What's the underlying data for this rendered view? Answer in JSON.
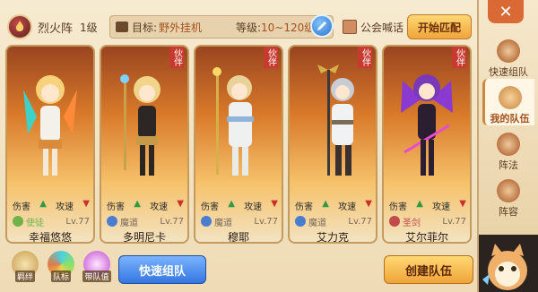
{
  "header": {
    "formation_name": "烈火阵",
    "formation_level": "1级",
    "target_label": "目标:",
    "target_value": "野外挂机",
    "level_label": "等级:",
    "level_value": "10~120级",
    "guild_label": "公会喊话",
    "start_match_label": "开始匹配"
  },
  "cards": [
    {
      "name": "幸福悠悠",
      "class": "使徒",
      "level": "Lv.77",
      "role_left": "伤害",
      "role_right": "攻速",
      "partner_tag": "",
      "class_color": "#6fb24a"
    },
    {
      "name": "多明尼卡",
      "class": "魔道",
      "level": "Lv.77",
      "role_left": "伤害",
      "role_right": "攻速",
      "partner_tag": "伙伴",
      "class_color": "#4a7cd0"
    },
    {
      "name": "穆耶",
      "class": "魔道",
      "level": "Lv.77",
      "role_left": "伤害",
      "role_right": "攻速",
      "partner_tag": "伙伴",
      "class_color": "#4a7cd0"
    },
    {
      "name": "艾力克",
      "class": "魔道",
      "level": "Lv.77",
      "role_left": "伤害",
      "role_right": "攻速",
      "partner_tag": "伙伴",
      "class_color": "#4a7cd0"
    },
    {
      "name": "艾尔菲尔",
      "class": "圣剑",
      "level": "Lv.77",
      "role_left": "伤害",
      "role_right": "攻速",
      "partner_tag": "伙伴",
      "class_color": "#c24a4a"
    }
  ],
  "bottom": {
    "icons": [
      {
        "label": "羁绊",
        "icon": "bond-icon"
      },
      {
        "label": "队标",
        "icon": "team-flag-icon"
      },
      {
        "label": "带队值",
        "icon": "star-icon"
      }
    ],
    "quick_team_label": "快速组队",
    "create_team_label": "创建队伍"
  },
  "sidebar": {
    "close_label": "✕",
    "items": [
      {
        "label": "快速组队",
        "icon": "quick-team-icon"
      },
      {
        "label": "我的队伍",
        "icon": "my-team-icon"
      },
      {
        "label": "阵法",
        "icon": "formation-icon"
      },
      {
        "label": "阵容",
        "icon": "lineup-icon"
      }
    ]
  }
}
